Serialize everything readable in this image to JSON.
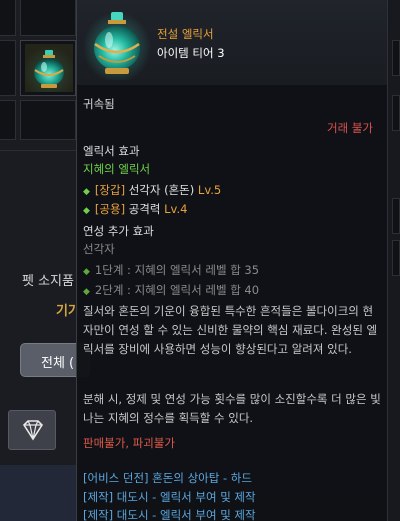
{
  "background": {
    "pet_label": "펫 소지품",
    "pet_sub_label": "기가",
    "all_button_label": "전체 (",
    "icons": {
      "slot_item": "potion-icon",
      "gem": "diamond-icon"
    }
  },
  "tooltip": {
    "grade": "전설 엘릭서",
    "tier": "아이템 티어 3",
    "bound": "귀속됨",
    "trade": "거래 불가",
    "effect_title": "엘릭서 효과",
    "effect_name": "지혜의 엘릭서",
    "effects": [
      {
        "tag": "[장갑]",
        "text": " 선각자 (혼돈) ",
        "level": "Lv.5"
      },
      {
        "tag": "[공용]",
        "text": " 공격력 ",
        "level": "Lv.4"
      }
    ],
    "refine_title": "연성 추가 효과",
    "refine_sub": "선각자",
    "refine_lines": [
      "1단계 : 지혜의 엘릭서 레벨 합 35",
      "2단계 : 지혜의 엘릭서 레벨 합 40"
    ],
    "description1": "질서와 혼돈의 기운이 융합된 특수한 흔적들은 볼다이크의 현자만이 연성 할 수 있는 신비한 물약의 핵심 재료다. 완성된 엘릭서를 장비에 사용하면 성능이 향상된다고 알려져 있다.",
    "description2": "분해 시, 정제 및 연성 가능 횟수를 많이 소진할수록 더 많은 빛나는 지혜의 정수를 획득할 수 있다.",
    "no_sell": "판매불가, 파괴불가",
    "sources": [
      "[어비스 던전] 혼돈의 상아탑 - 하드",
      "[제작] 대도시 - 엘릭서 부여 및 제작",
      "[제작] 대도시 - 엘릭서 부여 및 제작"
    ],
    "colors": {
      "grade_orange": "#e9a23b",
      "effect_green": "#6fd14a",
      "warning_red": "#d9534f",
      "source_blue": "#5aa7e0"
    }
  }
}
